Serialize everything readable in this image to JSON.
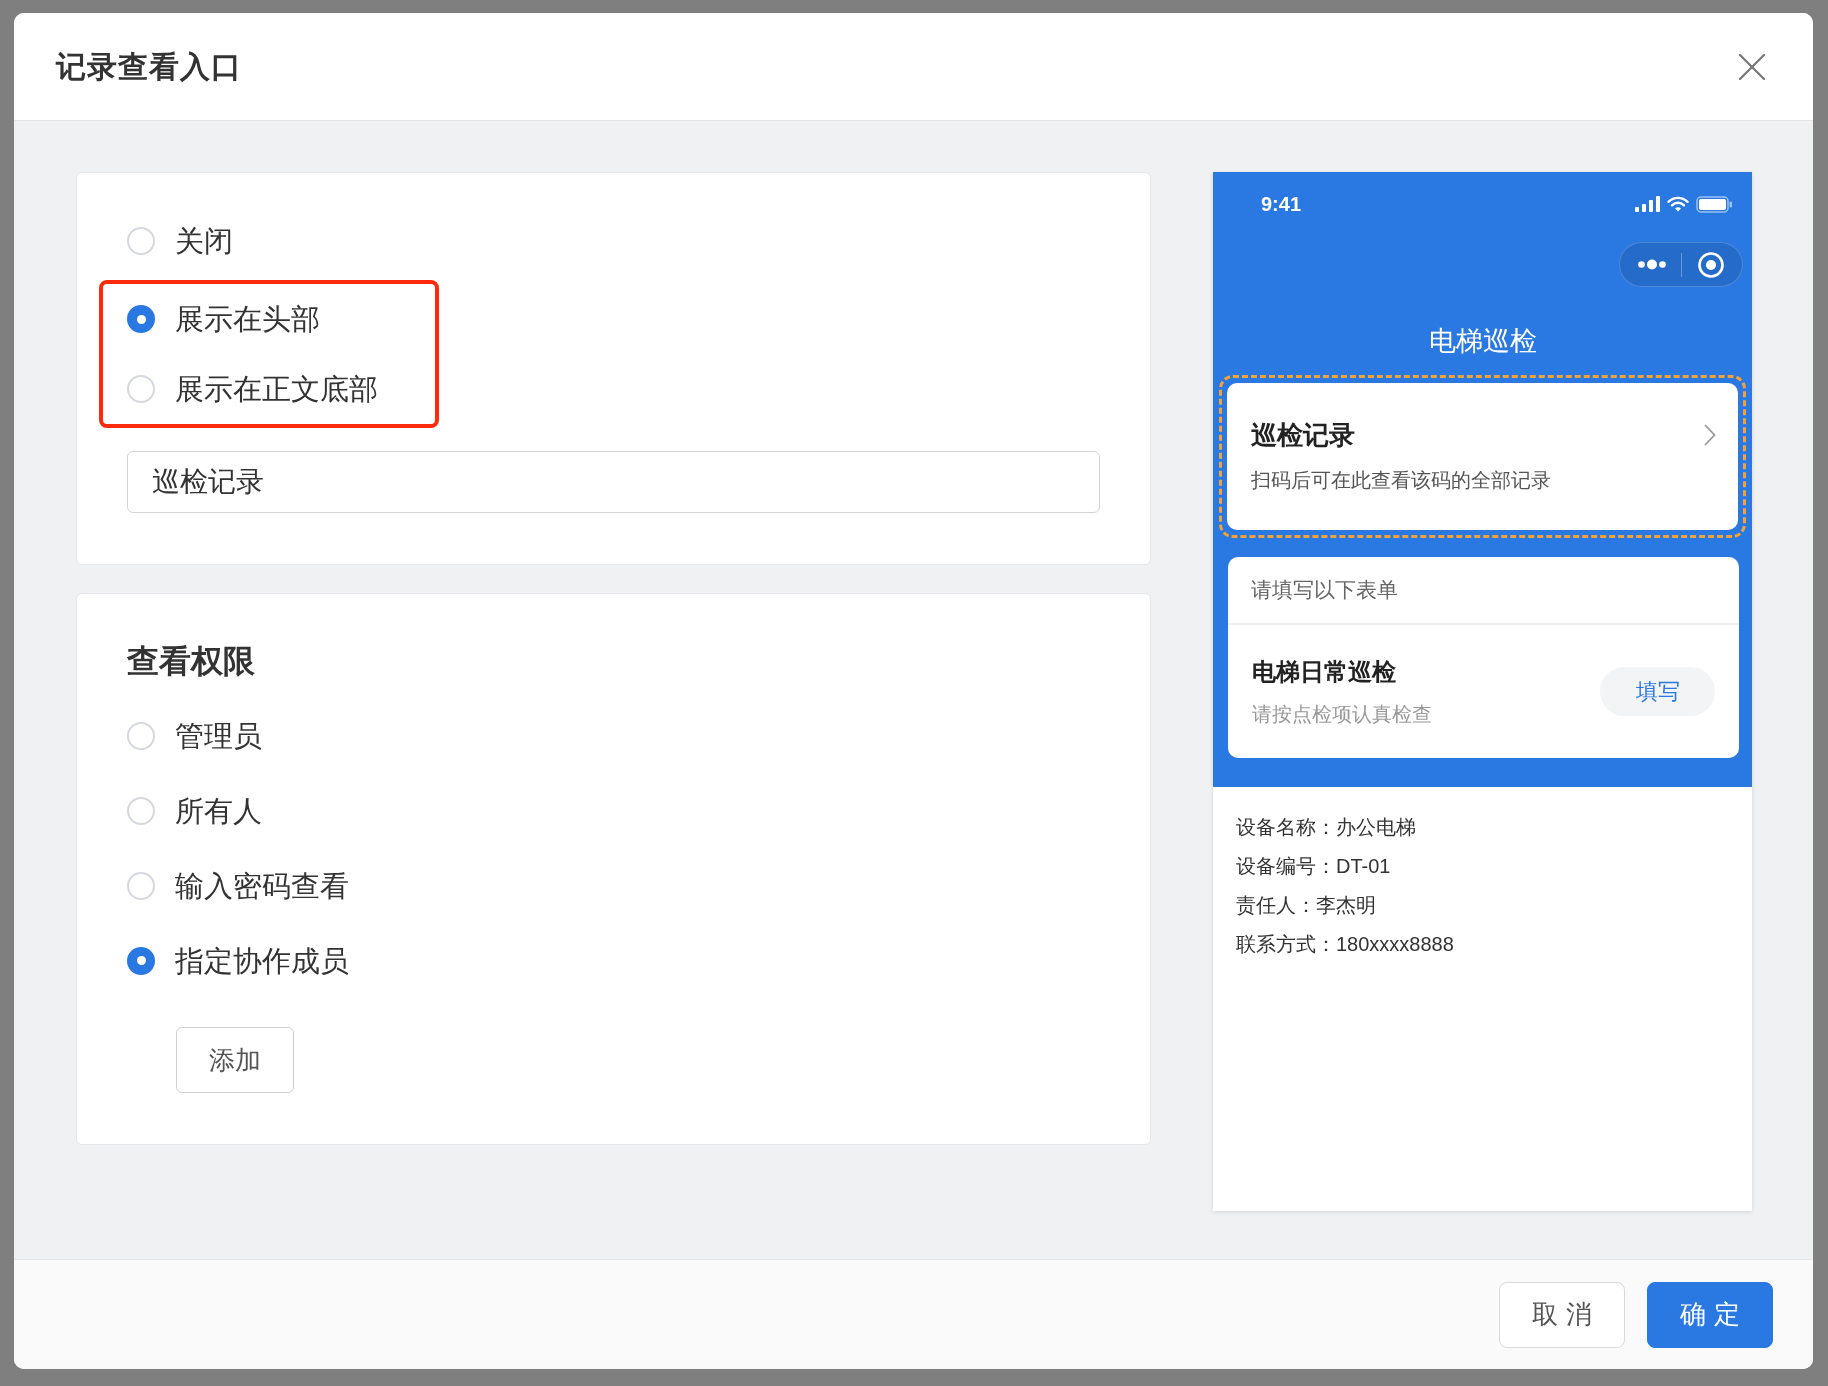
{
  "dialog": {
    "title": "记录查看入口"
  },
  "entry_options": [
    {
      "label": "关闭",
      "selected": false,
      "highlighted": false
    },
    {
      "label": "展示在头部",
      "selected": true,
      "highlighted": true
    },
    {
      "label": "展示在正文底部",
      "selected": false,
      "highlighted": true
    }
  ],
  "entry_name": {
    "value": "巡检记录"
  },
  "permission": {
    "title": "查看权限",
    "options": [
      {
        "label": "管理员",
        "selected": false
      },
      {
        "label": "所有人",
        "selected": false
      },
      {
        "label": "输入密码查看",
        "selected": false
      },
      {
        "label": "指定协作成员",
        "selected": true
      }
    ],
    "add_button": "添加"
  },
  "preview": {
    "status_time": "9:41",
    "page_title": "电梯巡检",
    "record_card": {
      "title": "巡检记录",
      "subtitle": "扫码后可在此查看该码的全部记录",
      "highlighted": true
    },
    "form_card": {
      "header": "请填写以下表单",
      "title": "电梯日常巡检",
      "subtitle": "请按点检项认真检查",
      "button": "填写"
    },
    "info": [
      "设备名称：办公电梯",
      "设备编号：DT-01",
      "责任人：李杰明",
      "联系方式：180xxxx8888"
    ]
  },
  "footer": {
    "buttons": [
      {
        "label": "取 消",
        "kind": "secondary"
      },
      {
        "label": "确 定",
        "kind": "primary"
      }
    ]
  }
}
